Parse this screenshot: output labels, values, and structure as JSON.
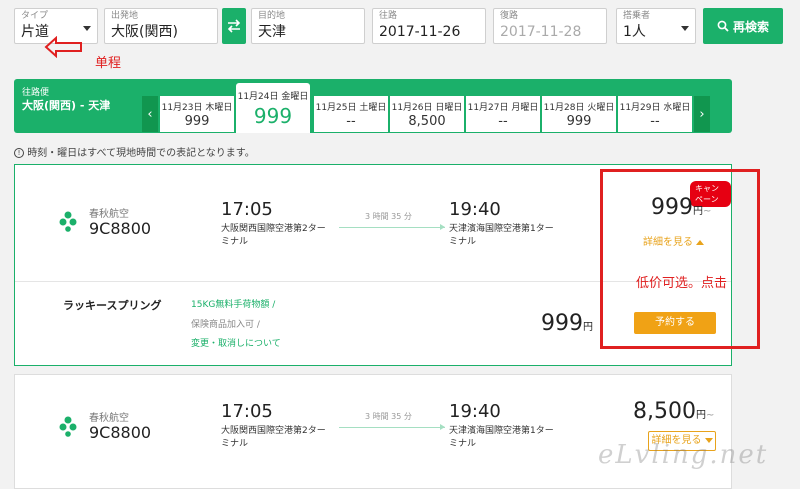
{
  "search": {
    "type_label": "タイプ",
    "type_value": "片道",
    "from_label": "出発地",
    "from_value": "大阪(関西)",
    "to_label": "目的地",
    "to_value": "天津",
    "depart_label": "往路",
    "depart_value": "2017-11-26",
    "return_label": "復路",
    "return_value": "2017-11-28",
    "pax_label": "搭乗者",
    "pax_value": "1人",
    "search_button": "再検索"
  },
  "annotations": {
    "single_trip": "单程",
    "low_price": "低价可选。点击",
    "watermark": "eLvling.net"
  },
  "date_bar": {
    "route_label": "往路便",
    "route": "大阪(関西) - 天津",
    "days": [
      {
        "label": "11月23日 木曜日",
        "price": "999"
      },
      {
        "label": "11月24日 金曜日",
        "price": "999"
      },
      {
        "label": "11月25日 土曜日",
        "price": "--"
      },
      {
        "label": "11月26日 日曜日",
        "price": "8,500"
      },
      {
        "label": "11月27日 月曜日",
        "price": "--"
      },
      {
        "label": "11月28日 火曜日",
        "price": "999"
      },
      {
        "label": "11月29日 水曜日",
        "price": "--"
      }
    ]
  },
  "notice": "時刻・曜日はすべて現地時間での表記となります。",
  "results": [
    {
      "airline": "春秋航空",
      "flight": "9C8800",
      "dep_time": "17:05",
      "dep_airport": "大阪関西国際空港第2ターミナル",
      "duration": "3 時間 35 分",
      "arr_time": "19:40",
      "arr_airport": "天津濱海国際空港第1ターミナル",
      "price": "999",
      "yen": "円",
      "tilde": "~",
      "campaign": "キャンペーン",
      "detail": "詳細を見る",
      "fare": {
        "name": "ラッキースプリング",
        "attr1": "15KG無料手荷物額 /",
        "attr2": "保険商品加入可 /",
        "attr3": "変更・取消しについて",
        "price": "999",
        "yen": "円",
        "book": "予約する"
      }
    },
    {
      "airline": "春秋航空",
      "flight": "9C8800",
      "dep_time": "17:05",
      "dep_airport": "大阪関西国際空港第2ターミナル",
      "duration": "3 時間 35 分",
      "arr_time": "19:40",
      "arr_airport": "天津濱海国際空港第1ターミナル",
      "price": "8,500",
      "yen": "円",
      "tilde": "~",
      "detail": "詳細を見る"
    }
  ],
  "colors": {
    "brand_green": "#1bb06a",
    "accent_orange": "#f0a215",
    "annotation_red": "#e02020"
  }
}
